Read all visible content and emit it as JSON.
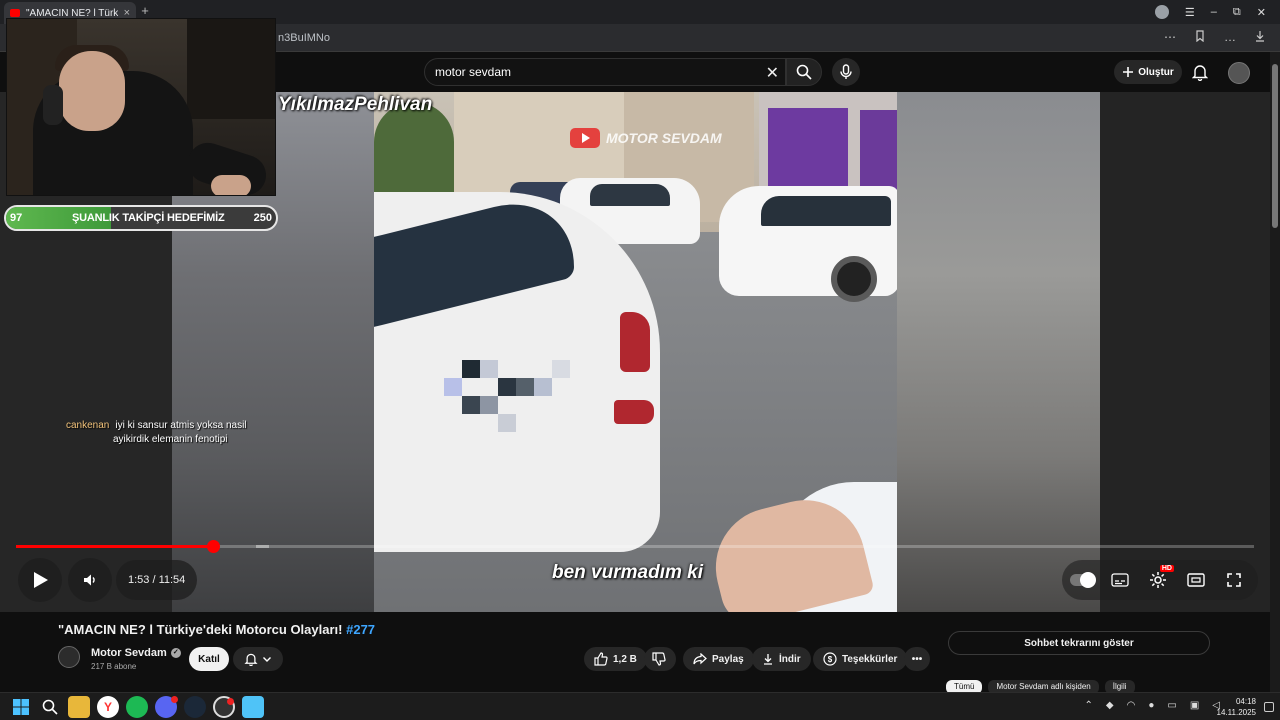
{
  "browser": {
    "tab_title": "\"AMACIN NE? l Türkiye",
    "tab_close": "×",
    "new_tab": "+",
    "url_fragment": "n3BuIMNo",
    "controls": {
      "menu": "☰",
      "minimize": "–",
      "maximize": "⧉",
      "close": "✕"
    }
  },
  "youtube_header": {
    "search_value": "motor sevdam",
    "search_clear": "✕",
    "create_label": "Oluştur"
  },
  "stream_overlay": {
    "name_text": "YıkılmazPehlivan",
    "goal": {
      "current": "97",
      "label": "ŞUANLIK TAKİPÇİ HEDEFİMİZ",
      "target": "250",
      "progress_fraction": 0.388
    },
    "chat": {
      "user": "cankenan",
      "line1": "iyi ki sansur atmis yoksa nasil",
      "line2": "ayikirdik elemanin fenotipi"
    }
  },
  "video": {
    "watermark": "MOTOR SEVDAM",
    "caption": "ben vurmadım ki"
  },
  "player": {
    "time": "1:53 / 11:54",
    "played_fraction": 0.159,
    "loaded_start_fraction": 0.194,
    "hd_badge": "HD"
  },
  "info": {
    "title_main": "\"AMACIN NE? l Türkiye'deki Motorcu Olayları!",
    "title_tag": "#277",
    "channel_name": "Motor Sevdam",
    "subscribers": "217 B abone",
    "join_label": "Katıl",
    "like_count": "1,2 B",
    "share_label": "Paylaş",
    "download_label": "İndir",
    "thanks_label": "Teşekkürler",
    "more_label": "•••",
    "chat_replay_label": "Sohbet tekrarını göster",
    "chips": [
      "Tümü",
      "Motor Sevdam adlı kişiden",
      "İlgili"
    ]
  },
  "taskbar": {
    "clock_time": "04:18",
    "clock_date": "14.11.2025",
    "yandex_letter": "Y",
    "discord_badge": "24"
  },
  "colors": {
    "accent_red": "#ff0000",
    "goal_green": "#5fb84f",
    "hashtag_blue": "#3ea6ff",
    "chat_user": "#f1c27a"
  }
}
